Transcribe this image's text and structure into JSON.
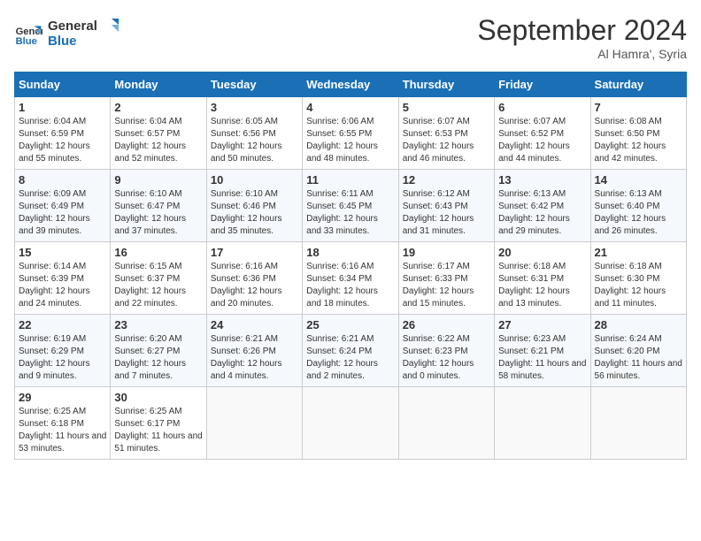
{
  "logo": {
    "line1": "General",
    "line2": "Blue"
  },
  "title": "September 2024",
  "location": "Al Hamra', Syria",
  "days_header": [
    "Sunday",
    "Monday",
    "Tuesday",
    "Wednesday",
    "Thursday",
    "Friday",
    "Saturday"
  ],
  "weeks": [
    [
      {
        "day": "1",
        "sunrise": "Sunrise: 6:04 AM",
        "sunset": "Sunset: 6:59 PM",
        "daylight": "Daylight: 12 hours and 55 minutes."
      },
      {
        "day": "2",
        "sunrise": "Sunrise: 6:04 AM",
        "sunset": "Sunset: 6:57 PM",
        "daylight": "Daylight: 12 hours and 52 minutes."
      },
      {
        "day": "3",
        "sunrise": "Sunrise: 6:05 AM",
        "sunset": "Sunset: 6:56 PM",
        "daylight": "Daylight: 12 hours and 50 minutes."
      },
      {
        "day": "4",
        "sunrise": "Sunrise: 6:06 AM",
        "sunset": "Sunset: 6:55 PM",
        "daylight": "Daylight: 12 hours and 48 minutes."
      },
      {
        "day": "5",
        "sunrise": "Sunrise: 6:07 AM",
        "sunset": "Sunset: 6:53 PM",
        "daylight": "Daylight: 12 hours and 46 minutes."
      },
      {
        "day": "6",
        "sunrise": "Sunrise: 6:07 AM",
        "sunset": "Sunset: 6:52 PM",
        "daylight": "Daylight: 12 hours and 44 minutes."
      },
      {
        "day": "7",
        "sunrise": "Sunrise: 6:08 AM",
        "sunset": "Sunset: 6:50 PM",
        "daylight": "Daylight: 12 hours and 42 minutes."
      }
    ],
    [
      {
        "day": "8",
        "sunrise": "Sunrise: 6:09 AM",
        "sunset": "Sunset: 6:49 PM",
        "daylight": "Daylight: 12 hours and 39 minutes."
      },
      {
        "day": "9",
        "sunrise": "Sunrise: 6:10 AM",
        "sunset": "Sunset: 6:47 PM",
        "daylight": "Daylight: 12 hours and 37 minutes."
      },
      {
        "day": "10",
        "sunrise": "Sunrise: 6:10 AM",
        "sunset": "Sunset: 6:46 PM",
        "daylight": "Daylight: 12 hours and 35 minutes."
      },
      {
        "day": "11",
        "sunrise": "Sunrise: 6:11 AM",
        "sunset": "Sunset: 6:45 PM",
        "daylight": "Daylight: 12 hours and 33 minutes."
      },
      {
        "day": "12",
        "sunrise": "Sunrise: 6:12 AM",
        "sunset": "Sunset: 6:43 PM",
        "daylight": "Daylight: 12 hours and 31 minutes."
      },
      {
        "day": "13",
        "sunrise": "Sunrise: 6:13 AM",
        "sunset": "Sunset: 6:42 PM",
        "daylight": "Daylight: 12 hours and 29 minutes."
      },
      {
        "day": "14",
        "sunrise": "Sunrise: 6:13 AM",
        "sunset": "Sunset: 6:40 PM",
        "daylight": "Daylight: 12 hours and 26 minutes."
      }
    ],
    [
      {
        "day": "15",
        "sunrise": "Sunrise: 6:14 AM",
        "sunset": "Sunset: 6:39 PM",
        "daylight": "Daylight: 12 hours and 24 minutes."
      },
      {
        "day": "16",
        "sunrise": "Sunrise: 6:15 AM",
        "sunset": "Sunset: 6:37 PM",
        "daylight": "Daylight: 12 hours and 22 minutes."
      },
      {
        "day": "17",
        "sunrise": "Sunrise: 6:16 AM",
        "sunset": "Sunset: 6:36 PM",
        "daylight": "Daylight: 12 hours and 20 minutes."
      },
      {
        "day": "18",
        "sunrise": "Sunrise: 6:16 AM",
        "sunset": "Sunset: 6:34 PM",
        "daylight": "Daylight: 12 hours and 18 minutes."
      },
      {
        "day": "19",
        "sunrise": "Sunrise: 6:17 AM",
        "sunset": "Sunset: 6:33 PM",
        "daylight": "Daylight: 12 hours and 15 minutes."
      },
      {
        "day": "20",
        "sunrise": "Sunrise: 6:18 AM",
        "sunset": "Sunset: 6:31 PM",
        "daylight": "Daylight: 12 hours and 13 minutes."
      },
      {
        "day": "21",
        "sunrise": "Sunrise: 6:18 AM",
        "sunset": "Sunset: 6:30 PM",
        "daylight": "Daylight: 12 hours and 11 minutes."
      }
    ],
    [
      {
        "day": "22",
        "sunrise": "Sunrise: 6:19 AM",
        "sunset": "Sunset: 6:29 PM",
        "daylight": "Daylight: 12 hours and 9 minutes."
      },
      {
        "day": "23",
        "sunrise": "Sunrise: 6:20 AM",
        "sunset": "Sunset: 6:27 PM",
        "daylight": "Daylight: 12 hours and 7 minutes."
      },
      {
        "day": "24",
        "sunrise": "Sunrise: 6:21 AM",
        "sunset": "Sunset: 6:26 PM",
        "daylight": "Daylight: 12 hours and 4 minutes."
      },
      {
        "day": "25",
        "sunrise": "Sunrise: 6:21 AM",
        "sunset": "Sunset: 6:24 PM",
        "daylight": "Daylight: 12 hours and 2 minutes."
      },
      {
        "day": "26",
        "sunrise": "Sunrise: 6:22 AM",
        "sunset": "Sunset: 6:23 PM",
        "daylight": "Daylight: 12 hours and 0 minutes."
      },
      {
        "day": "27",
        "sunrise": "Sunrise: 6:23 AM",
        "sunset": "Sunset: 6:21 PM",
        "daylight": "Daylight: 11 hours and 58 minutes."
      },
      {
        "day": "28",
        "sunrise": "Sunrise: 6:24 AM",
        "sunset": "Sunset: 6:20 PM",
        "daylight": "Daylight: 11 hours and 56 minutes."
      }
    ],
    [
      {
        "day": "29",
        "sunrise": "Sunrise: 6:25 AM",
        "sunset": "Sunset: 6:18 PM",
        "daylight": "Daylight: 11 hours and 53 minutes."
      },
      {
        "day": "30",
        "sunrise": "Sunrise: 6:25 AM",
        "sunset": "Sunset: 6:17 PM",
        "daylight": "Daylight: 11 hours and 51 minutes."
      },
      null,
      null,
      null,
      null,
      null
    ]
  ]
}
